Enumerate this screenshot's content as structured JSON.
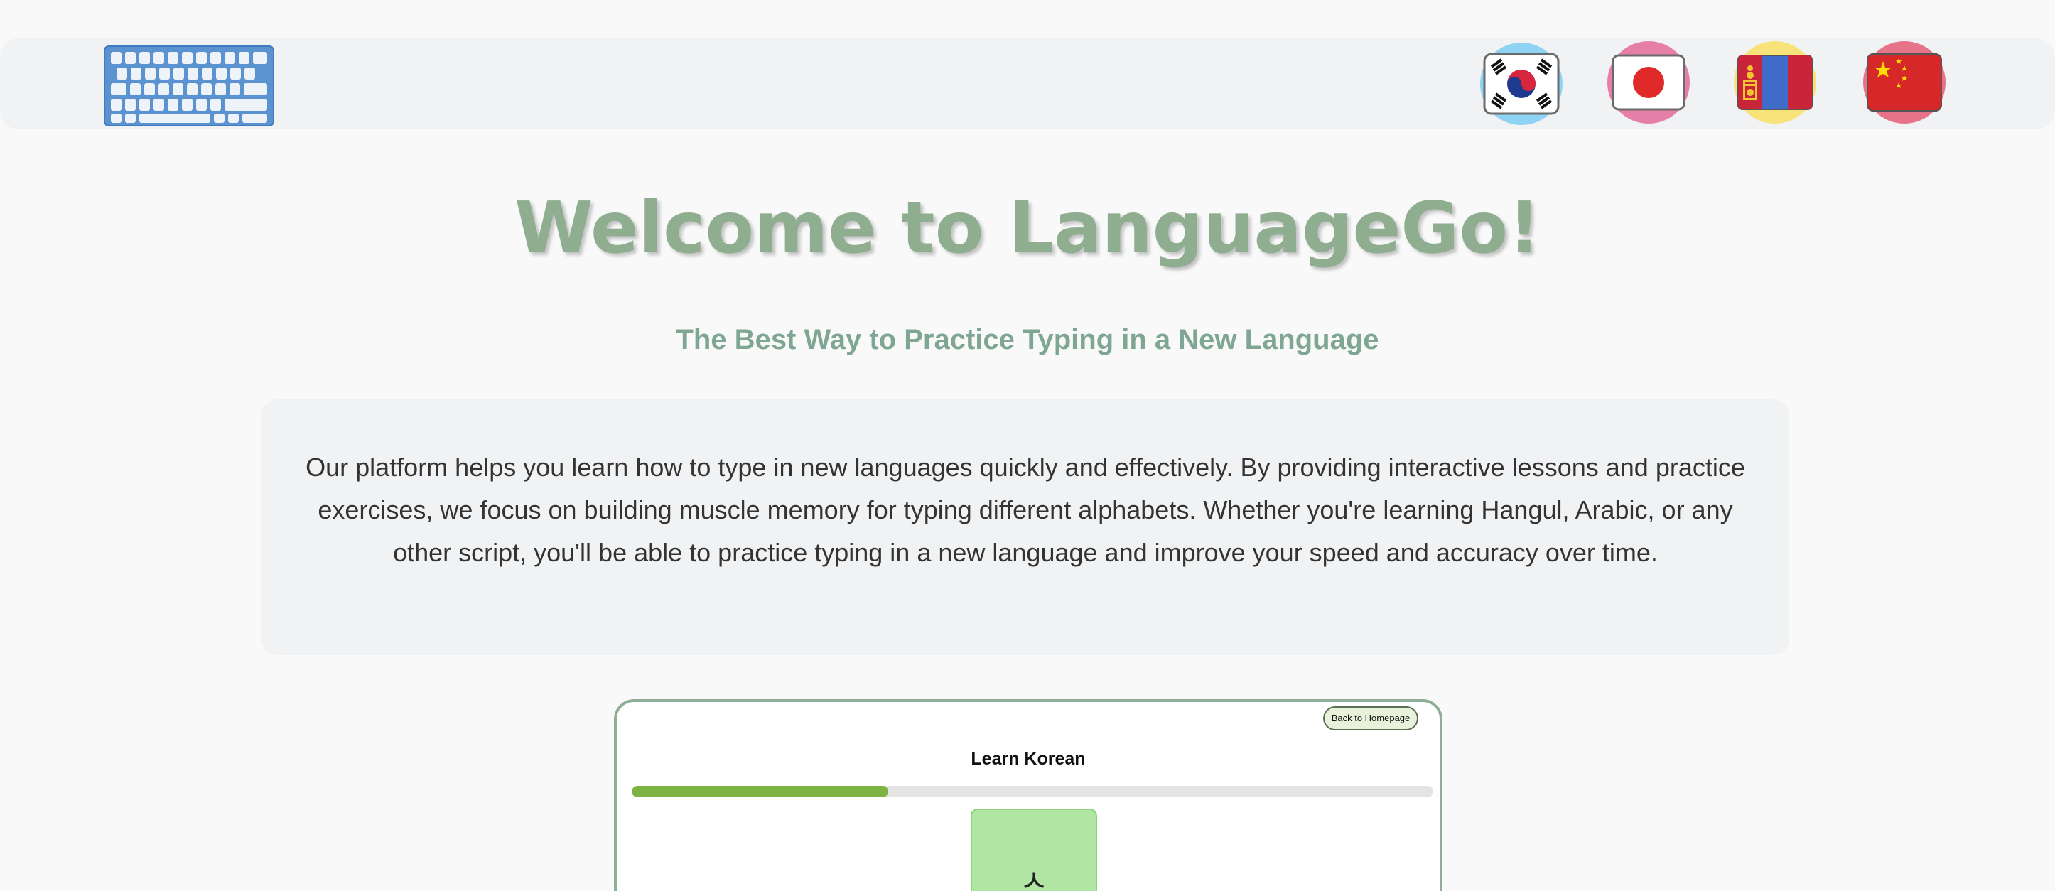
{
  "header": {
    "logo_icon": "keyboard-icon",
    "flags": [
      {
        "icon": "south-korea-flag-icon",
        "halo": "#8fd3f4"
      },
      {
        "icon": "japan-flag-icon",
        "halo": "#e57fa8"
      },
      {
        "icon": "mongolia-flag-icon",
        "halo": "#f7e37a"
      },
      {
        "icon": "china-flag-icon",
        "halo": "#e6738a"
      }
    ]
  },
  "hero": {
    "title": "Welcome to LanguageGo!",
    "subtitle": "The Best Way to Practice Typing in a New Language",
    "title_color": "#8fae90",
    "subtitle_color": "#7ea692"
  },
  "description": {
    "text": "Our platform helps you learn how to type in new languages quickly and effectively. By providing interactive lessons and practice exercises, we focus on building muscle memory for typing different alphabets. Whether you're learning Hangul, Arabic, or any other script, you'll be able to practice typing in a new language and improve your speed and accuracy over time."
  },
  "preview": {
    "back_button_label": "Back to Homepage",
    "lesson_title": "Learn Korean",
    "progress_fraction": 0.32,
    "progress_color": "#7cb342",
    "current_character": "ㅅ"
  }
}
